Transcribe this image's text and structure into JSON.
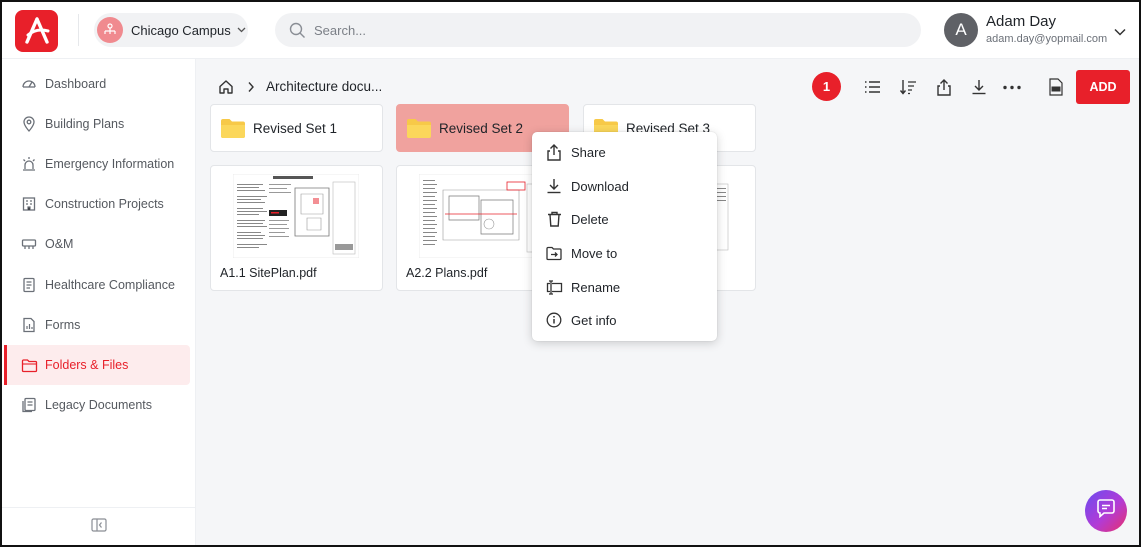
{
  "header": {
    "campus_label": "Chicago Campus",
    "search_placeholder": "Search...",
    "user_initial": "A",
    "user_name": "Adam Day",
    "user_email": "adam.day@yopmail.com"
  },
  "sidebar": {
    "items": [
      {
        "label": "Dashboard",
        "icon": "dashboard-gauge-icon"
      },
      {
        "label": "Building Plans",
        "icon": "map-pin-icon"
      },
      {
        "label": "Emergency Information",
        "icon": "siren-icon"
      },
      {
        "label": "Construction Projects",
        "icon": "building-icon"
      },
      {
        "label": "O&M",
        "icon": "tools-icon"
      },
      {
        "label": "Healthcare Compliance",
        "icon": "checklist-icon"
      },
      {
        "label": "Forms",
        "icon": "form-icon"
      },
      {
        "label": "Folders & Files",
        "icon": "folder-icon",
        "active": true
      },
      {
        "label": "Legacy Documents",
        "icon": "documents-icon"
      }
    ]
  },
  "breadcrumb": {
    "current": "Architecture docu..."
  },
  "toolbar": {
    "badge_count": "1",
    "add_label": "ADD"
  },
  "folders": [
    {
      "name": "Revised Set 1"
    },
    {
      "name": "Revised Set 2",
      "selected": true
    },
    {
      "name": "Revised Set 3"
    }
  ],
  "files": [
    {
      "name": "A1.1 SitePlan.pdf"
    },
    {
      "name": "A2.2 Plans.pdf"
    }
  ],
  "context_menu": {
    "items": [
      {
        "label": "Share",
        "icon": "share-icon"
      },
      {
        "label": "Download",
        "icon": "download-icon"
      },
      {
        "label": "Delete",
        "icon": "trash-icon"
      },
      {
        "label": "Move to",
        "icon": "move-to-icon"
      },
      {
        "label": "Rename",
        "icon": "rename-icon"
      },
      {
        "label": "Get info",
        "icon": "info-icon"
      }
    ]
  },
  "colors": {
    "brand": "#e8202a",
    "selected_folder": "#f0a29e",
    "folder_yellow": "#f7c948"
  }
}
